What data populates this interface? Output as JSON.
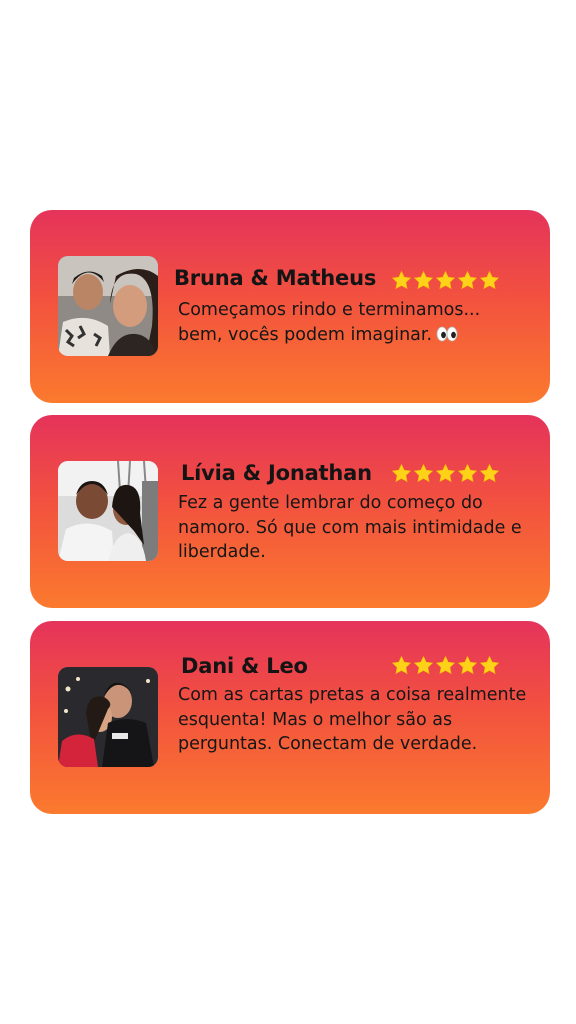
{
  "colors": {
    "card_top": "#e5335b",
    "card_bottom": "#fb7a2e",
    "star": "#ffd21a",
    "text": "#161616"
  },
  "reviews": [
    {
      "name": "Bruna & Matheus",
      "rating": 5,
      "text": "Começamos rindo e terminamos... bem, vocês podem imaginar.",
      "emoji": "eyes-emoji-icon"
    },
    {
      "name": "Lívia & Jonathan",
      "rating": 5,
      "text": "Fez a gente lembrar do começo do namoro. Só que com mais intimidade e liberdade."
    },
    {
      "name": "Dani & Leo",
      "rating": 5,
      "text": "Com as cartas pretas a coisa realmente esquenta! Mas o melhor são as perguntas. Conectam de verdade."
    }
  ]
}
